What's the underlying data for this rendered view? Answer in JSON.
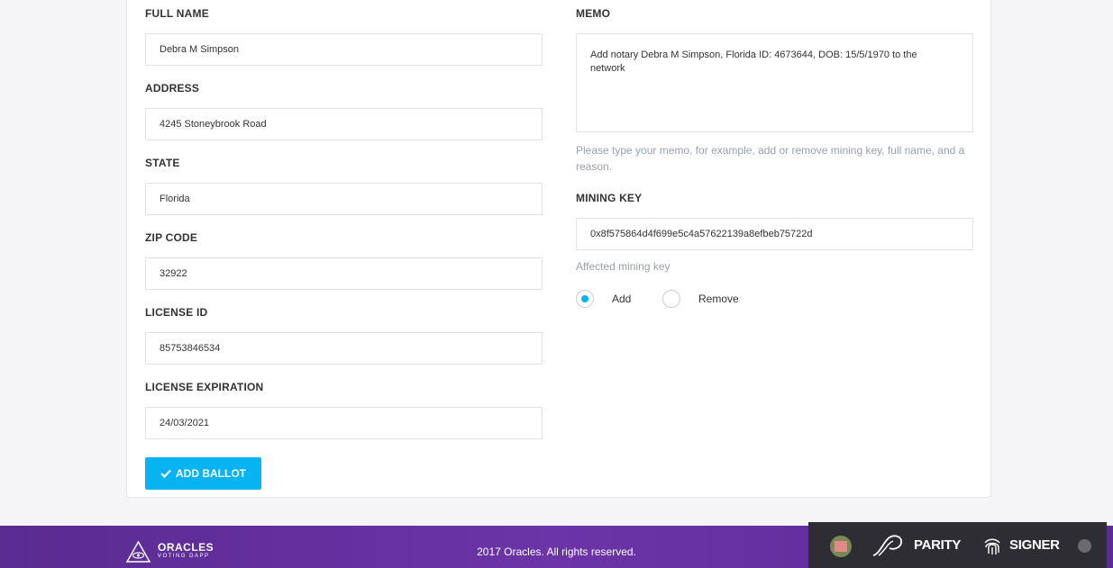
{
  "form": {
    "full_name": {
      "label": "FULL NAME",
      "value": "Debra M Simpson"
    },
    "address": {
      "label": "ADDRESS",
      "value": "4245 Stoneybrook Road"
    },
    "state": {
      "label": "STATE",
      "value": "Florida"
    },
    "zip_code": {
      "label": "ZIP CODE",
      "value": "32922"
    },
    "license_id": {
      "label": "LICENSE ID",
      "value": "85753846534"
    },
    "license_expiration": {
      "label": "LICENSE EXPIRATION",
      "value": "24/03/2021"
    },
    "memo": {
      "label": "MEMO",
      "value": "Add notary Debra M Simpson, Florida ID: 4673644, DOB: 15/5/1970 to the network",
      "hint": "Please type your memo, for example, add or remove mining key, full name, and a reason."
    },
    "mining_key": {
      "label": "MINING KEY",
      "value": "0x8f575864d4f699e5c4a57622139a8efbeb75722d",
      "hint": "Affected mining key"
    },
    "action": {
      "options": [
        "Add",
        "Remove"
      ],
      "selected": "Add"
    },
    "submit_label": "ADD BALLOT"
  },
  "footer": {
    "logo_main": "ORACLES",
    "logo_sub": "VOTING DAPP",
    "copyright": "2017 Oracles. All rights reserved."
  },
  "parity_bar": {
    "parity_label": "PARITY",
    "signer_label": "SIGNER"
  },
  "colors": {
    "accent": "#08b3f2",
    "footer_bg": "#5a2b91",
    "parity_bg": "#2d2d33"
  }
}
